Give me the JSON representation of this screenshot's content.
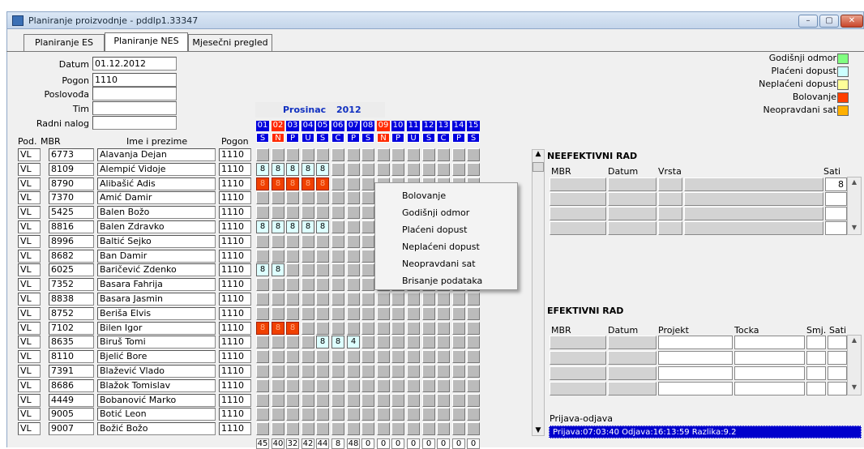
{
  "window": {
    "title": "Planiranje proizvodnje - pddlp1.33347",
    "min": "–",
    "max": "▢",
    "close": "✕"
  },
  "tabs": [
    {
      "label": "Planiranje ES"
    },
    {
      "label": "Planiranje NES"
    },
    {
      "label": "Mjesečni pregled"
    }
  ],
  "form": {
    "datum_label": "Datum",
    "datum": "01.12.2012",
    "pogon_label": "Pogon",
    "pogon": "1110",
    "poslovoda_label": "Poslovođa",
    "poslovoda": "",
    "tim_label": "Tim",
    "tim": "",
    "radni_nalog_label": "Radni nalog",
    "radni_nalog": ""
  },
  "month": {
    "name": "Prosinac",
    "year": "2012"
  },
  "days": [
    {
      "n": "01",
      "d": "S",
      "red": false
    },
    {
      "n": "02",
      "d": "N",
      "red": true
    },
    {
      "n": "03",
      "d": "P",
      "red": false
    },
    {
      "n": "04",
      "d": "U",
      "red": false
    },
    {
      "n": "05",
      "d": "S",
      "red": false
    },
    {
      "n": "06",
      "d": "Č",
      "red": false
    },
    {
      "n": "07",
      "d": "P",
      "red": false
    },
    {
      "n": "08",
      "d": "S",
      "red": false
    },
    {
      "n": "09",
      "d": "N",
      "red": true
    },
    {
      "n": "10",
      "d": "P",
      "red": false
    },
    {
      "n": "11",
      "d": "U",
      "red": false
    },
    {
      "n": "12",
      "d": "S",
      "red": false
    },
    {
      "n": "13",
      "d": "Č",
      "red": false
    },
    {
      "n": "14",
      "d": "P",
      "red": false
    },
    {
      "n": "15",
      "d": "S",
      "red": false
    }
  ],
  "columns": {
    "pod": "Pod.",
    "mbr": "MBR",
    "ime": "Ime i prezime",
    "pogon": "Pogon"
  },
  "employees": [
    {
      "pod": "VL",
      "mbr": "6773",
      "ime": "Alavanja Dejan",
      "pogon": "1110",
      "cells": [
        "",
        "",
        "",
        "",
        "",
        "",
        "",
        "",
        "",
        "",
        "",
        "",
        "",
        "",
        ""
      ]
    },
    {
      "pod": "VL",
      "mbr": "8109",
      "ime": "Alempić Vidoje",
      "pogon": "1110",
      "cells": [
        "8",
        "8",
        "8",
        "8",
        "8",
        "",
        "",
        "",
        "",
        "",
        "",
        "",
        "",
        "",
        ""
      ]
    },
    {
      "pod": "VL",
      "mbr": "8790",
      "ime": "Alibašić Adis",
      "pogon": "1110",
      "cells": [
        "B8",
        "B8",
        "B8",
        "B8",
        "B8",
        "",
        "",
        "",
        "",
        "",
        "",
        "",
        "",
        "",
        ""
      ]
    },
    {
      "pod": "VL",
      "mbr": "7370",
      "ime": "Amić Damir",
      "pogon": "1110",
      "cells": [
        "",
        "",
        "",
        "",
        "",
        "",
        "",
        "",
        "",
        "",
        "",
        "",
        "",
        "",
        ""
      ]
    },
    {
      "pod": "VL",
      "mbr": "5425",
      "ime": "Balen Božo",
      "pogon": "1110",
      "cells": [
        "",
        "",
        "",
        "",
        "",
        "",
        "",
        "",
        "",
        "",
        "",
        "",
        "",
        "",
        ""
      ]
    },
    {
      "pod": "VL",
      "mbr": "8816",
      "ime": "Balen Zdravko",
      "pogon": "1110",
      "cells": [
        "8",
        "8",
        "8",
        "8",
        "8",
        "",
        "",
        "",
        "",
        "",
        "",
        "",
        "",
        "",
        ""
      ]
    },
    {
      "pod": "VL",
      "mbr": "8996",
      "ime": "Baltić Sejko",
      "pogon": "1110",
      "cells": [
        "",
        "",
        "",
        "",
        "",
        "",
        "",
        "",
        "",
        "",
        "",
        "",
        "",
        "",
        ""
      ]
    },
    {
      "pod": "VL",
      "mbr": "8682",
      "ime": "Ban Damir",
      "pogon": "1110",
      "cells": [
        "",
        "",
        "",
        "",
        "",
        "",
        "",
        "",
        "",
        "",
        "",
        "",
        "",
        "",
        ""
      ]
    },
    {
      "pod": "VL",
      "mbr": "6025",
      "ime": "Baričević Zdenko",
      "pogon": "1110",
      "cells": [
        "8",
        "8",
        "",
        "",
        "",
        "",
        "",
        "",
        "",
        "",
        "",
        "",
        "",
        "",
        ""
      ]
    },
    {
      "pod": "VL",
      "mbr": "7352",
      "ime": "Basara Fahrija",
      "pogon": "1110",
      "cells": [
        "",
        "",
        "",
        "",
        "",
        "",
        "",
        "",
        "",
        "",
        "",
        "",
        "",
        "",
        ""
      ]
    },
    {
      "pod": "VL",
      "mbr": "8838",
      "ime": "Basara Jasmin",
      "pogon": "1110",
      "cells": [
        "",
        "",
        "",
        "",
        "",
        "",
        "",
        "",
        "",
        "",
        "",
        "",
        "",
        "",
        ""
      ]
    },
    {
      "pod": "VL",
      "mbr": "8752",
      "ime": "Beriša Elvis",
      "pogon": "1110",
      "cells": [
        "",
        "",
        "",
        "",
        "",
        "",
        "",
        "",
        "",
        "",
        "",
        "",
        "",
        "",
        ""
      ]
    },
    {
      "pod": "VL",
      "mbr": "7102",
      "ime": "Bilen Igor",
      "pogon": "1110",
      "cells": [
        "B8",
        "B8",
        "B8",
        "",
        "",
        "",
        "",
        "",
        "",
        "",
        "",
        "",
        "",
        "",
        ""
      ]
    },
    {
      "pod": "VL",
      "mbr": "8635",
      "ime": "Biruš Tomi",
      "pogon": "1110",
      "cells": [
        "",
        "",
        "",
        "",
        "8",
        "8",
        "4",
        "",
        "",
        "",
        "",
        "",
        "",
        "",
        ""
      ]
    },
    {
      "pod": "VL",
      "mbr": "8110",
      "ime": "Bjelić Bore",
      "pogon": "1110",
      "cells": [
        "",
        "",
        "",
        "",
        "",
        "",
        "",
        "",
        "",
        "",
        "",
        "",
        "",
        "",
        ""
      ]
    },
    {
      "pod": "VL",
      "mbr": "7391",
      "ime": "Blažević Vlado",
      "pogon": "1110",
      "cells": [
        "",
        "",
        "",
        "",
        "",
        "",
        "",
        "",
        "",
        "",
        "",
        "",
        "",
        "",
        ""
      ]
    },
    {
      "pod": "VL",
      "mbr": "8686",
      "ime": "Blažok Tomislav",
      "pogon": "1110",
      "cells": [
        "",
        "",
        "",
        "",
        "",
        "",
        "",
        "",
        "",
        "",
        "",
        "",
        "",
        "",
        ""
      ]
    },
    {
      "pod": "VL",
      "mbr": "4449",
      "ime": "Bobanović Marko",
      "pogon": "1110",
      "cells": [
        "",
        "",
        "",
        "",
        "",
        "",
        "",
        "",
        "",
        "",
        "",
        "",
        "",
        "",
        ""
      ]
    },
    {
      "pod": "VL",
      "mbr": "9005",
      "ime": "Botić Leon",
      "pogon": "1110",
      "cells": [
        "",
        "",
        "",
        "",
        "",
        "",
        "",
        "",
        "",
        "",
        "",
        "",
        "",
        "",
        ""
      ]
    },
    {
      "pod": "VL",
      "mbr": "9007",
      "ime": "Božić Božo",
      "pogon": "1110",
      "cells": [
        "",
        "",
        "",
        "",
        "",
        "",
        "",
        "",
        "",
        "",
        "",
        "",
        "",
        "",
        ""
      ]
    }
  ],
  "totals": [
    "45",
    "40",
    "32",
    "42",
    "44",
    "8",
    "48",
    "0",
    "0",
    "0",
    "0",
    "0",
    "0",
    "0",
    "0"
  ],
  "legend": [
    {
      "label": "Godišnji odmor",
      "color": "#80ff80"
    },
    {
      "label": "Plaćeni dopust",
      "color": "#ccffff"
    },
    {
      "label": "Neplaćeni dopust",
      "color": "#ffff99"
    },
    {
      "label": "Bolovanje",
      "color": "#ff4000"
    },
    {
      "label": "Neopravdani sat",
      "color": "#ffb000"
    }
  ],
  "context_menu": [
    "Bolovanje",
    "Godišnji odmor",
    "Plaćeni dopust",
    "Neplaćeni dopust",
    "Neopravdani sat",
    "Brisanje podataka"
  ],
  "neefektivni": {
    "title": "NEEFEKTIVNI RAD",
    "cols": [
      "MBR",
      "Datum",
      "Vrsta",
      "Sati"
    ],
    "first_sati": "8"
  },
  "efektivni": {
    "title": "EFEKTIVNI RAD",
    "cols": [
      "MBR",
      "Datum",
      "Projekt",
      "Tocka",
      "Smj.",
      "Sati"
    ]
  },
  "prijava": {
    "label": "Prijava-odjava",
    "value": "Prijava:07:03:40 Odjava:16:13:59 Razlika:9.2"
  }
}
